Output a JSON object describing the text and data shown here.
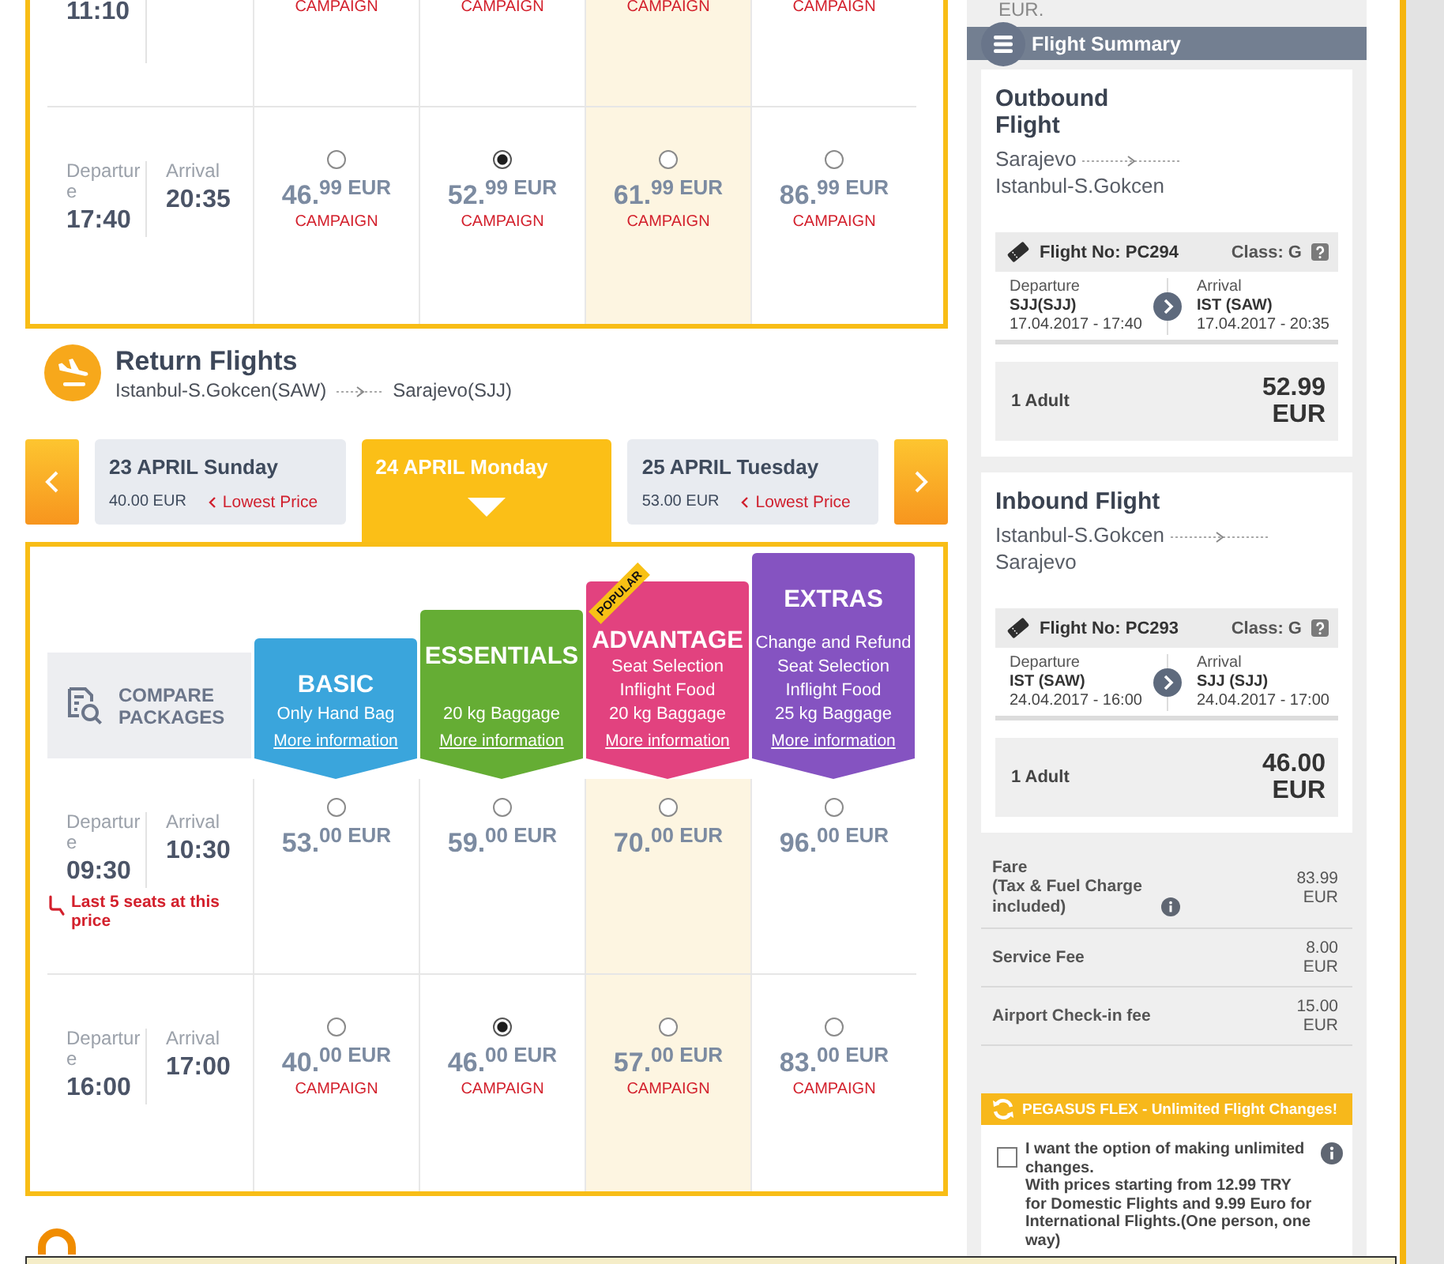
{
  "outbound_flights": {
    "columns": [
      {
        "highlighted": false
      },
      {
        "highlighted": false
      },
      {
        "highlighted": true
      },
      {
        "highlighted": false
      }
    ],
    "rows": [
      {
        "departure_time": "11:10",
        "fares": [
          {
            "campaign": "CAMPAIGN"
          },
          {
            "campaign": "CAMPAIGN"
          },
          {
            "campaign": "CAMPAIGN"
          },
          {
            "campaign": "CAMPAIGN"
          }
        ]
      },
      {
        "departure_label": "Departure",
        "departure_time": "17:40",
        "arrival_label": "Arrival",
        "arrival_time": "20:35",
        "fares": [
          {
            "selected": false,
            "price": "46.$^{99 EUR}$",
            "campaign": "CAMPAIGN"
          },
          {
            "selected": true,
            "price": "52.$^{99 EUR}$",
            "campaign": "CAMPAIGN"
          },
          {
            "selected": false,
            "price": "61.$^{99 EUR}$",
            "campaign": "CAMPAIGN"
          },
          {
            "selected": false,
            "price": "86.$^{99 EUR}$",
            "campaign": "CAMPAIGN"
          }
        ]
      }
    ]
  },
  "return_flights": {
    "title": "Return Flights",
    "from": "Istanbul-S.Gokcen(SAW)",
    "to": "Sarajevo(SJJ)",
    "days": [
      {
        "date": "23 APRIL Sunday",
        "price": "40.00 EUR",
        "note": "Lowest Price",
        "selected": false
      },
      {
        "date": "24 APRIL Monday",
        "selected": true
      },
      {
        "date": "25 APRIL Tuesday",
        "price": "53.00 EUR",
        "note": "Lowest Price",
        "selected": false
      }
    ],
    "compare_label": "COMPARE PACKAGES",
    "packages": [
      {
        "name": "BASIC",
        "color": "#3aa5dc",
        "features": [
          "Only Hand Bag"
        ],
        "link": "More information",
        "highlighted": false
      },
      {
        "name": "ESSENTIALS",
        "color": "#65ad34",
        "features": [
          "20 kg Baggage"
        ],
        "link": "More information",
        "highlighted": false
      },
      {
        "name": "ADVANTAGE",
        "color": "#e2427f",
        "badge": "POPULAR",
        "features": [
          "Seat Selection",
          "Inflight Food",
          "20 kg Baggage"
        ],
        "link": "More information",
        "highlighted": true
      },
      {
        "name": "EXTRAS",
        "color": "#8553c1",
        "features": [
          "Change and Refund",
          "Seat Selection",
          "Inflight Food",
          "25 kg Baggage"
        ],
        "link": "More information",
        "highlighted": false
      }
    ],
    "rows": [
      {
        "departure_label": "Departure",
        "departure_time": "09:30",
        "arrival_label": "Arrival",
        "arrival_time": "10:30",
        "note": "Last 5 seats at this price",
        "fares": [
          {
            "selected": false,
            "price": "53.$^{00 EUR}$"
          },
          {
            "selected": false,
            "price": "59.$^{00 EUR}$"
          },
          {
            "selected": false,
            "price": "70.$^{00 EUR}$"
          },
          {
            "selected": false,
            "price": "96.$^{00 EUR}$"
          }
        ]
      },
      {
        "departure_label": "Departure",
        "departure_time": "16:00",
        "arrival_label": "Arrival",
        "arrival_time": "17:00",
        "fares": [
          {
            "selected": false,
            "price": "40.$^{00 EUR}$",
            "campaign": "CAMPAIGN"
          },
          {
            "selected": true,
            "price": "46.$^{00 EUR}$",
            "campaign": "CAMPAIGN"
          },
          {
            "selected": false,
            "price": "57.$^{00 EUR}$",
            "campaign": "CAMPAIGN"
          },
          {
            "selected": false,
            "price": "83.$^{00 EUR}$",
            "campaign": "CAMPAIGN"
          }
        ]
      }
    ]
  },
  "summary": {
    "top_text": "EUR.",
    "title": "Flight Summary",
    "flights": [
      {
        "title": "Outbound Flight",
        "from": "Sarajevo",
        "to": "Istanbul-S.Gokcen",
        "flight_no": "Flight No: PC294",
        "class": "Class: G",
        "departure": {
          "label": "Departure",
          "code": "SJJ(SJJ)",
          "time": "17.04.2017 - 17:40"
        },
        "arrival": {
          "label": "Arrival",
          "code": "IST (SAW)",
          "time": "17.04.2017 - 20:35"
        },
        "passengers": "1 Adult",
        "price": "52.99 EUR"
      },
      {
        "title": "Inbound Flight",
        "from": "Istanbul-S.Gokcen",
        "to": "Sarajevo",
        "flight_no": "Flight No: PC293",
        "class": "Class: G",
        "departure": {
          "label": "Departure",
          "code": "IST (SAW)",
          "time": "24.04.2017 - 16:00"
        },
        "arrival": {
          "label": "Arrival",
          "code": "SJJ (SJJ)",
          "time": "24.04.2017 - 17:00"
        },
        "passengers": "1 Adult",
        "price": "46.00 EUR"
      }
    ],
    "fees": [
      {
        "label": "Fare",
        "note": "(Tax & Fuel Charge included)",
        "amount": "83.99 EUR"
      },
      {
        "label": "Service Fee",
        "amount": "8.00 EUR"
      },
      {
        "label": "Airport Check-in fee",
        "amount": "15.00 EUR"
      }
    ],
    "flex": {
      "title": "PEGASUS FLEX - Unlimited Flight Changes!",
      "checked": false,
      "option": "I want the option of making unlimited changes.",
      "description": "With prices starting from 12.99 TRY for Domestic Flights and 9.99 Euro for International Flights.(One person, one way)"
    }
  }
}
